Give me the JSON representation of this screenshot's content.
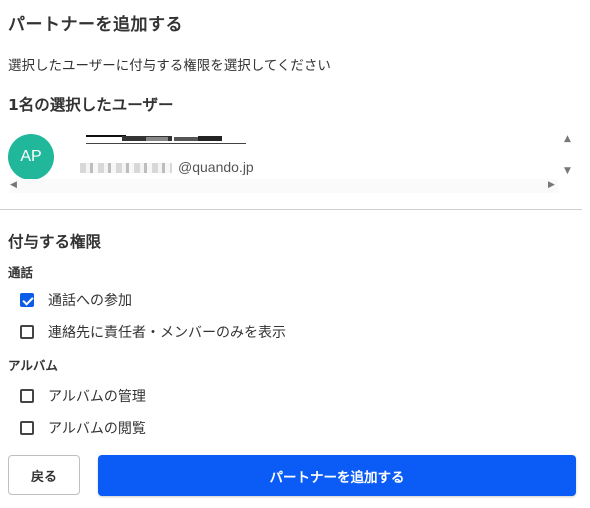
{
  "dialog": {
    "title": "パートナーを追加する",
    "description": "選択したユーザーに付与する権限を選択してください"
  },
  "selected_users": {
    "heading": "1名の選択したユーザー",
    "users": [
      {
        "initials": "AP",
        "avatar_color": "#20b79a",
        "email_domain": "@quando.jp"
      }
    ]
  },
  "permissions": {
    "heading": "付与する権限",
    "groups": [
      {
        "label": "通話",
        "items": [
          {
            "label": "通話への参加",
            "checked": true
          },
          {
            "label": "連絡先に責任者・メンバーのみを表示",
            "checked": false
          }
        ]
      },
      {
        "label": "アルバム",
        "items": [
          {
            "label": "アルバムの管理",
            "checked": false
          },
          {
            "label": "アルバムの閲覧",
            "checked": false
          }
        ]
      }
    ]
  },
  "buttons": {
    "back_label": "戻る",
    "add_label": "パートナーを追加する"
  },
  "colors": {
    "primary": "#0b5cf6",
    "checkbox_checked": "#0b5ce6",
    "avatar": "#20b79a"
  }
}
